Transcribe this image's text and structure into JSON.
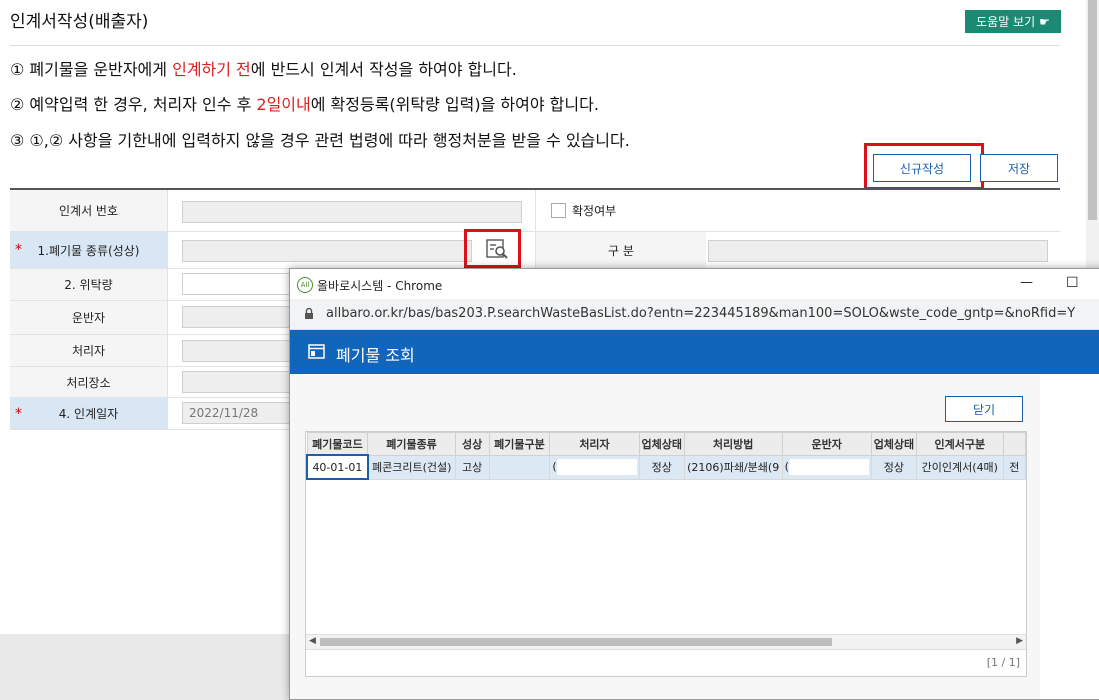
{
  "page": {
    "title": "인계서작성(배출자)",
    "help_label": "도움말 보기",
    "notice1_a": "① 폐기물을 운반자에게 ",
    "notice1_red": "인계하기 전",
    "notice1_b": "에 반드시 인계서 작성을 하여야 합니다.",
    "notice2_a": "② 예약입력 한 경우, 처리자 인수 후 ",
    "notice2_red": "2일이내",
    "notice2_b": "에 확정등록(위탁량 입력)을 하여야 합니다.",
    "notice3": "③ ①,② 사항을 기한내에 입력하지 않을 경우 관련 법령에 따라 행정처분을 받을 수 있습니다.",
    "new_label": "신규작성",
    "save_label": "저장",
    "highlight_color": "#e0101a"
  },
  "form": {
    "doc_no_label": "인계서 번호",
    "confirm_label": "확정여부",
    "waste_type_label": "1.폐기물 종류(성상)",
    "category_label": "구 분",
    "qty_label": "2. 위탁량",
    "carrier_label": "운반자",
    "processor_label": "처리자",
    "site_label": "처리장소",
    "date_label": "4. 인계일자",
    "date_value": "2022/11/28",
    "required_mark": "*"
  },
  "popup": {
    "window_title": "올바로시스템 - Chrome",
    "logo_text": "All",
    "url": "allbaro.or.kr/bas/bas203.P.searchWasteBasList.do?entn=223445189&man100=SOLO&wste_code_gntp=&noRfid=Y",
    "minimize_glyph": "—",
    "maximize_glyph": "☐",
    "header_title": "폐기물 조회",
    "close_label": "닫기",
    "columns": [
      "폐기물코드",
      "폐기물종류",
      "성상",
      "폐기물구분",
      "처리자",
      "업체상태",
      "처리방법",
      "운반자",
      "업체상태",
      "인계서구분",
      ""
    ],
    "row": [
      "40-01-01",
      "폐콘크리트(건설)",
      "고상",
      "",
      "(",
      "정상",
      "(2106)파쇄/분쇄(9",
      "(",
      "정상",
      "간이인계서(4매)",
      "전"
    ],
    "pager": "[1 / 1]"
  }
}
